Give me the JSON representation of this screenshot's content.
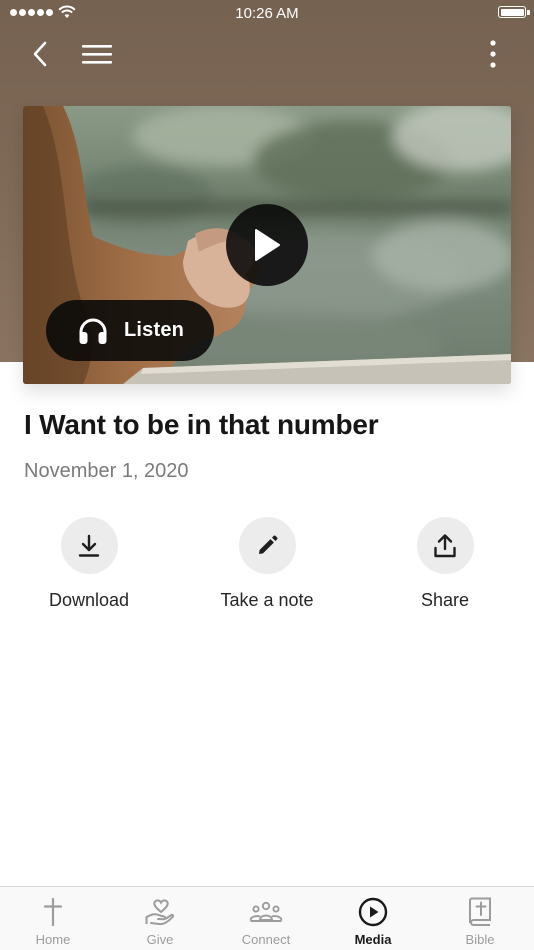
{
  "status_bar": {
    "time": "10:26 AM"
  },
  "nav": {
    "back_icon": "chevron-left-icon",
    "menu_icon": "hamburger-menu-icon",
    "more_icon": "more-vertical-icon"
  },
  "hero": {
    "play_icon": "play-icon",
    "listen_label": "Listen",
    "listen_icon": "headphones-icon"
  },
  "media": {
    "title": "I Want to be in that number",
    "date": "November 1, 2020"
  },
  "actions": [
    {
      "label": "Download",
      "icon": "download-icon"
    },
    {
      "label": "Take a note",
      "icon": "pencil-icon"
    },
    {
      "label": "Share",
      "icon": "share-icon"
    }
  ],
  "tabs": [
    {
      "label": "Home",
      "icon": "cross-icon",
      "active": false
    },
    {
      "label": "Give",
      "icon": "give-hand-heart-icon",
      "active": false
    },
    {
      "label": "Connect",
      "icon": "group-icon",
      "active": false
    },
    {
      "label": "Media",
      "icon": "play-circle-icon",
      "active": true
    },
    {
      "label": "Bible",
      "icon": "bible-icon",
      "active": false
    }
  ],
  "colors": {
    "header_brown": "#7d6856",
    "active_tab": "#1a1a1a",
    "inactive_tab": "#9c9c9c",
    "action_circle": "#ececed"
  }
}
